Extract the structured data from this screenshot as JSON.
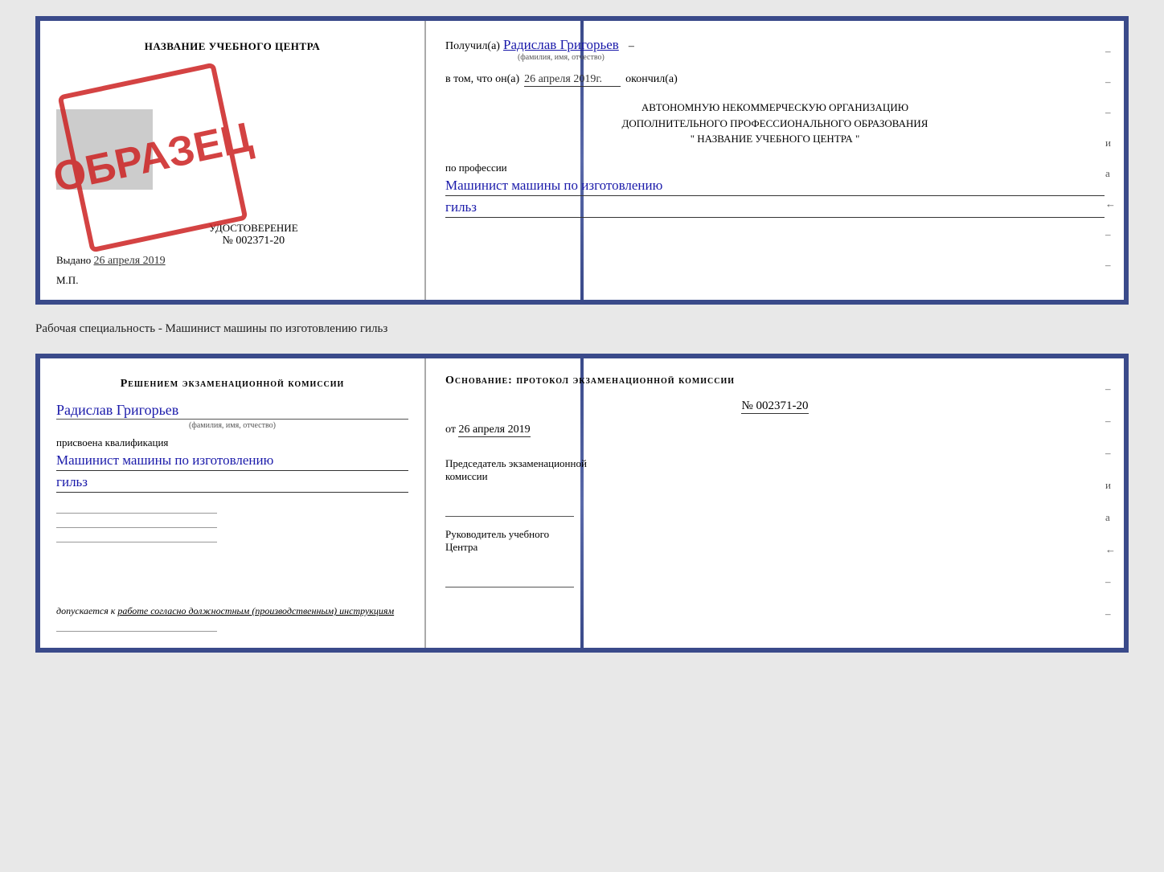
{
  "topDoc": {
    "leftPanel": {
      "schoolName": "НАЗВАНИЕ УЧЕБНОГО ЦЕНТРА",
      "udostoverenie": "УДОСТОВЕРЕНИЕ",
      "number": "№ 002371-20",
      "obrazec": "ОБРАЗЕЦ",
      "vydano": "Выдано",
      "vydanoDate": "26 апреля 2019",
      "mp": "М.П."
    },
    "rightPanel": {
      "poluchilLabel": "Получил(а)",
      "fioValue": "Радислав Григорьев",
      "fioHint": "(фамилия, имя, отчество)",
      "dash": "–",
      "vtomChto": "в том, что он(а)",
      "dateValue": "26 апреля 2019г.",
      "okonchilLabel": "окончил(а)",
      "org1": "АВТОНОМНУЮ НЕКОММЕРЧЕСКУЮ ОРГАНИЗАЦИЮ",
      "org2": "ДОПОЛНИТЕЛЬНОГО ПРОФЕССИОНАЛЬНОГО ОБРАЗОВАНИЯ",
      "orgName": "\" НАЗВАНИЕ УЧЕБНОГО ЦЕНТРА \"",
      "poProfessii": "по профессии",
      "profession1": "Машинист машины по изготовлению",
      "profession2": "гильз"
    }
  },
  "separatorText": "Рабочая специальность - Машинист машины по изготовлению гильз",
  "bottomDoc": {
    "leftPanel": {
      "resheniem": "Решением экзаменационной комиссии",
      "fio": "Радислав Григорьев",
      "fioHint": "(фамилия, имя, отчество)",
      "prisvoena": "присвоена квалификация",
      "kvalif1": "Машинист машины по изготовлению",
      "kvalif2": "гильз",
      "dopuskaetsya": "допускается к",
      "dopuskaetsyaLink": "работе согласно должностным (производственным) инструкциям"
    },
    "rightPanel": {
      "osnovanie": "Основание: протокол экзаменационной комиссии",
      "numberLabel": "№ 002371-20",
      "otLabel": "от",
      "otDate": "26 апреля 2019",
      "predsedatel1": "Председатель экзаменационной",
      "predsedatel2": "комиссии",
      "rukovoditel1": "Руководитель учебного",
      "rukovoditel2": "Центра"
    }
  }
}
